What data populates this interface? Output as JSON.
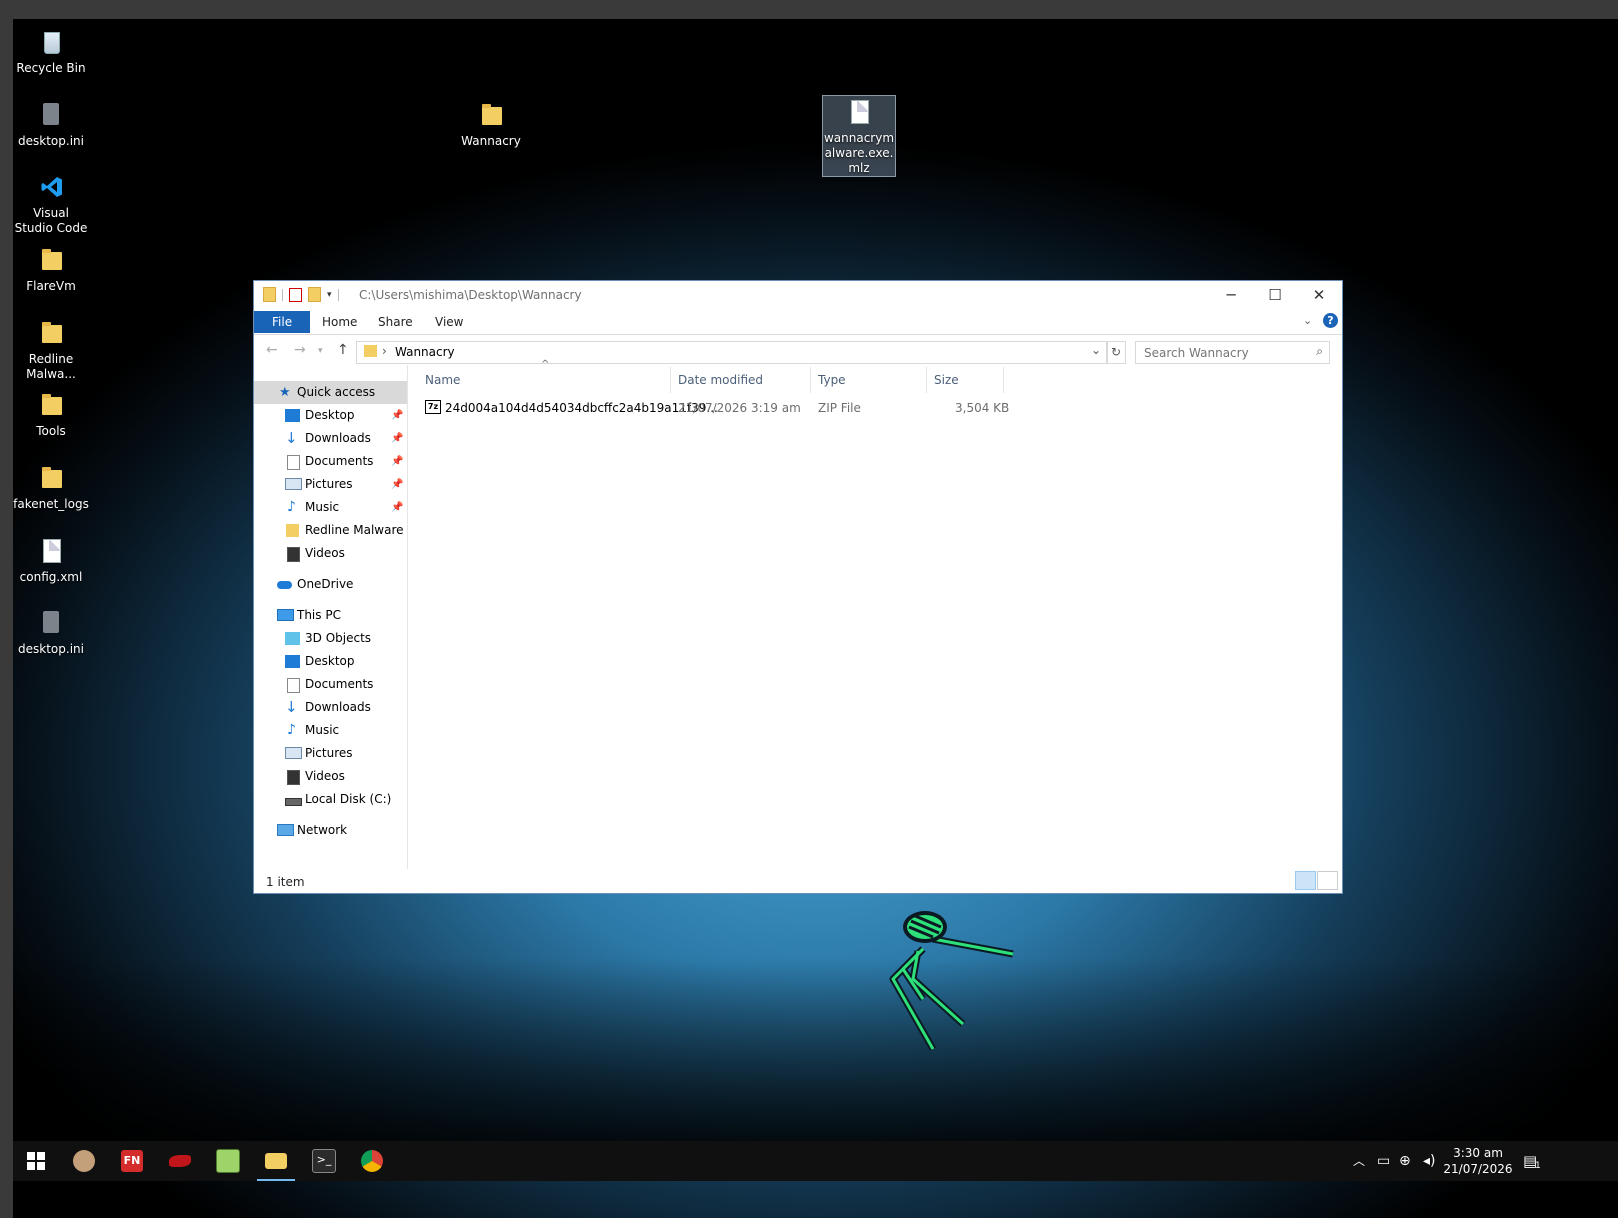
{
  "desktop": {
    "icons": [
      {
        "label": "Recycle Bin",
        "icon": "recycle-bin-icon"
      },
      {
        "label": "desktop.ini",
        "icon": "settings-file-icon"
      },
      {
        "label": "Visual Studio Code",
        "icon": "vscode-icon"
      },
      {
        "label": "FlareVm",
        "icon": "file-icon"
      },
      {
        "label": "Redline Malwa...",
        "icon": "folder-icon"
      },
      {
        "label": "Tools",
        "icon": "folder-icon"
      },
      {
        "label": "fakenet_logs",
        "icon": "folder-icon"
      },
      {
        "label": "config.xml",
        "icon": "file-icon"
      },
      {
        "label": "desktop.ini",
        "icon": "settings-file-icon"
      },
      {
        "label": "Wannacry",
        "icon": "folder-icon"
      },
      {
        "label": "wannacrymalware.exe.mlz",
        "icon": "file-icon"
      }
    ]
  },
  "explorer": {
    "title_path": "C:\\Users\\mishima\\Desktop\\Wannacry",
    "ribbon_tabs": [
      "File",
      "Home",
      "Share",
      "View"
    ],
    "address": "Wannacry",
    "search_placeholder": "Search Wannacry",
    "nav": {
      "quick_access": "Quick access",
      "quick_items": [
        "Desktop",
        "Downloads",
        "Documents",
        "Pictures",
        "Music",
        "Redline Malware Ar",
        "Videos"
      ],
      "onedrive": "OneDrive",
      "this_pc": "This PC",
      "pc_items": [
        "3D Objects",
        "Desktop",
        "Documents",
        "Downloads",
        "Music",
        "Pictures",
        "Videos",
        "Local Disk (C:)"
      ],
      "network": "Network"
    },
    "columns": {
      "name": "Name",
      "date": "Date modified",
      "type": "Type",
      "size": "Size"
    },
    "files": [
      {
        "name": "24d004a104d4d54034dbcffc2a4b19a11f39...",
        "date": "21/07/2026 3:19 am",
        "type": "ZIP File",
        "size": "3,504 KB",
        "icon": "7zip-archive-icon"
      }
    ],
    "status": "1 item"
  },
  "taskbar": {
    "apps": [
      "start-icon",
      "cutter-icon",
      "fakenet-icon",
      "pepper-icon",
      "notepad-plus-icon",
      "file-explorer-icon",
      "terminal-icon",
      "chrome-icon"
    ],
    "time": "3:30 am",
    "date": "21/07/2026",
    "notification_count": "1"
  },
  "colors": {
    "file_tab": "#1a64b8",
    "folder": "#f3cf63",
    "selection": "#d9d9d9",
    "accent": "#76b9ed"
  }
}
